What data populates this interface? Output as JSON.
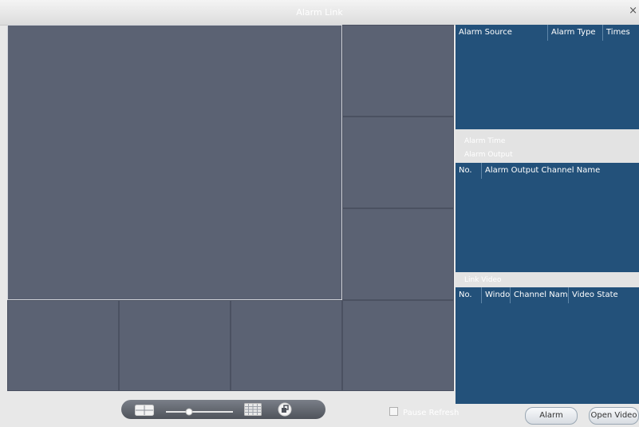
{
  "window": {
    "title": "Alarm Link",
    "close_glyph": "×"
  },
  "alarm_source": {
    "columns": [
      "Alarm Source",
      "Alarm Type",
      "Times"
    ]
  },
  "alarm_time": {
    "label": "Alarm Time"
  },
  "alarm_output": {
    "label": "Alarm Output",
    "columns": [
      "No.",
      "Alarm Output Channel Name"
    ]
  },
  "link_video": {
    "label": "Link Video",
    "columns": [
      "No.",
      "Windo",
      "Channel Name",
      "Video State"
    ]
  },
  "toolbar": {
    "icons": [
      "layout-2x2-icon",
      "zoom-slider",
      "layout-grid-icon",
      "fullscreen-icon"
    ]
  },
  "pause_refresh": {
    "label": "Pause Refresh",
    "checked": false
  },
  "buttons": {
    "alarm": "Alarm",
    "open_video": "Open Video"
  },
  "colors": {
    "video_bg": "#5b6273",
    "panel_blue": "#23517a"
  }
}
